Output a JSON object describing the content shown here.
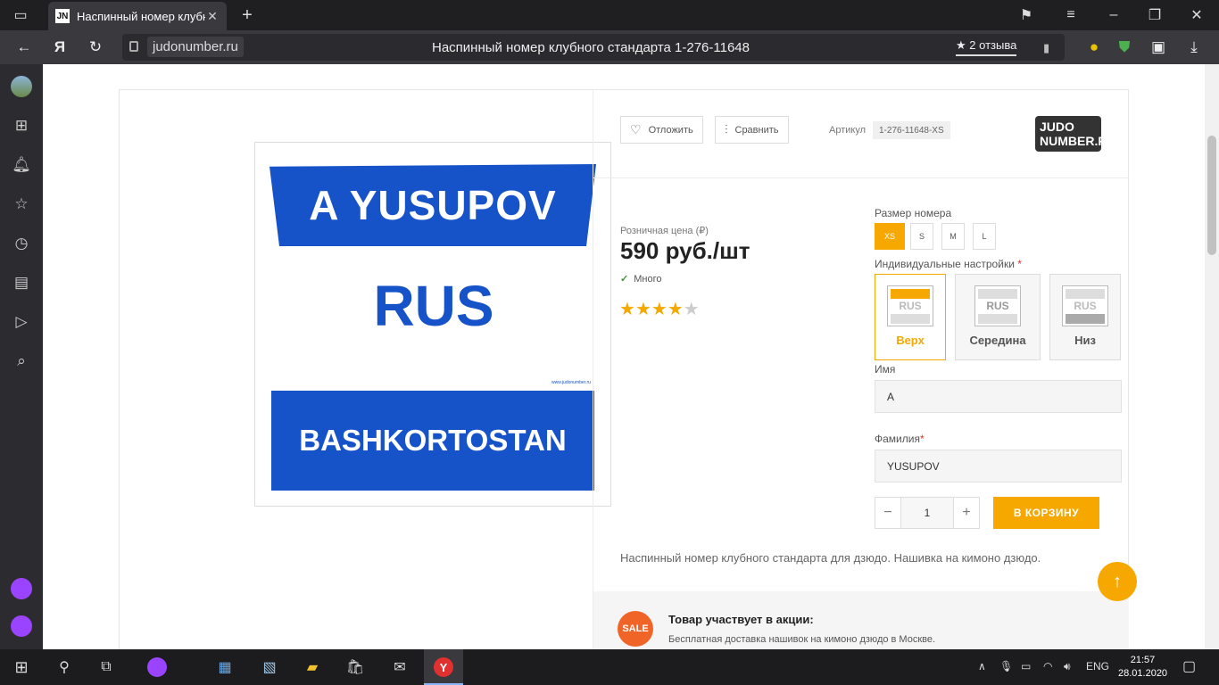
{
  "browser": {
    "tab_title": "Наспинный номер клубн",
    "tab_favicon": "JN",
    "domain": "judonumber.ru",
    "page_title": "Наспинный номер клубного стандарта 1-276-11648",
    "reviews": "2 отзыва",
    "yandex_logo": "Я"
  },
  "product": {
    "plate": {
      "top": "A YUSUPOV",
      "middle": "RUS",
      "url": "www.judonumber.ru",
      "bottom": "BASHKORTOSTAN"
    },
    "actions": {
      "wishlist": "Отложить",
      "compare": "Сравнить"
    },
    "sku_label": "Артикул",
    "sku_value": "1-276-11648-XS",
    "logo_line1": "JUDO",
    "logo_line2": "NUMBER.RU",
    "price_label": "Розничная цена (₽)",
    "price": "590 руб./шт",
    "stock": "Много",
    "rating": 4,
    "rating_max": 5
  },
  "options": {
    "size_label": "Размер номера",
    "sizes": [
      "XS",
      "S",
      "M",
      "L"
    ],
    "selected_size": "XS",
    "custom_label": "Индивидуальные настройки",
    "required_mark": "*",
    "positions": [
      {
        "label": "Верх",
        "thumb_text": "RUS"
      },
      {
        "label": "Середина",
        "thumb_text": "RUS"
      },
      {
        "label": "Низ",
        "thumb_text": "RUS"
      }
    ],
    "selected_position": "Верх",
    "first_name_label": "Имя",
    "first_name_value": "А",
    "last_name_label": "Фамилия",
    "last_name_value": "YUSUPOV",
    "quantity": "1",
    "cart_button": "В КОРЗИНУ"
  },
  "description": "Наспинный номер клубного стандарта для дзюдо. Нашивка на кимоно дзюдо.",
  "promo": {
    "badge": "SALE",
    "title": "Товар участвует в акции:",
    "text": "Бесплатная доставка нашивок на кимоно дзюдо в Москве."
  },
  "taskbar": {
    "lang": "ENG",
    "time": "21:57",
    "date": "28.01.2020"
  },
  "colors": {
    "accent": "#f7a800",
    "plate_blue": "#1652c8",
    "sale": "#f06428"
  }
}
